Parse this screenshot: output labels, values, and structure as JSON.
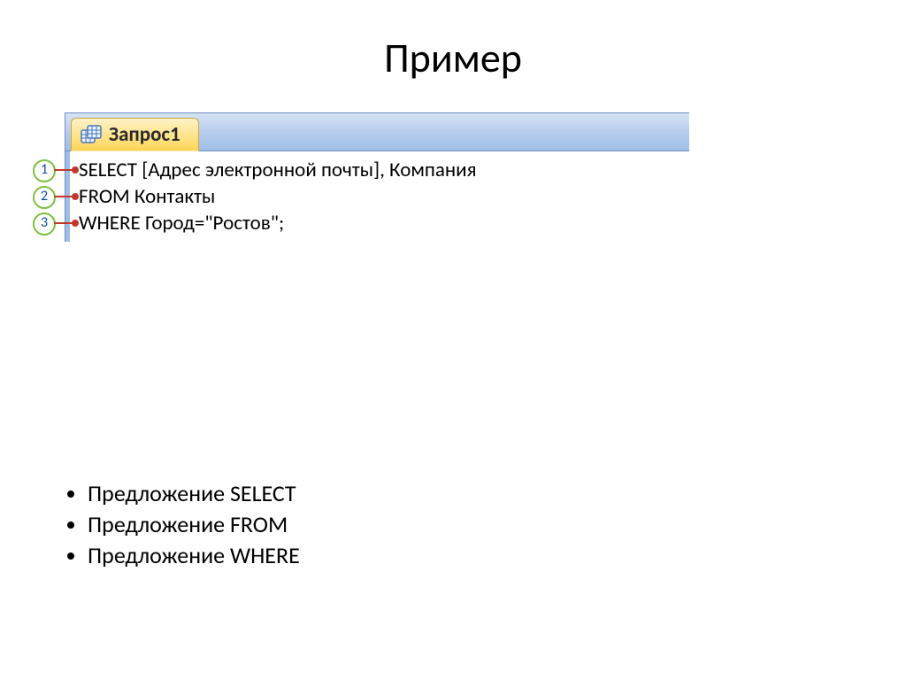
{
  "title": "Пример",
  "tab": {
    "label": "Запрос1",
    "icon": "query-icon"
  },
  "code_lines": [
    "SELECT [Адрес электронной почты], Компания",
    "FROM Контакты",
    "WHERE Город=\"Ростов\";"
  ],
  "callouts": [
    "1",
    "2",
    "3"
  ],
  "bullets": [
    "Предложение SELECT",
    "Предложение FROM",
    "Предложение WHERE"
  ]
}
